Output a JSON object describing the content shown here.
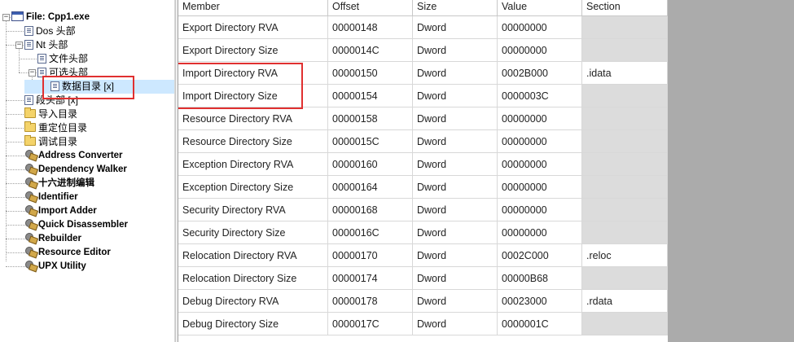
{
  "tree": {
    "items": [
      {
        "label": "File: Cpp1.exe",
        "icon": "window-icon",
        "bold": true,
        "expander": "minus"
      },
      {
        "label": "Dos 头部",
        "icon": "page-icon",
        "bold": false,
        "expander": ""
      },
      {
        "label": "Nt 头部",
        "icon": "page-icon",
        "bold": false,
        "expander": "minus"
      },
      {
        "label": "文件头部",
        "icon": "page-icon",
        "bold": false,
        "expander": ""
      },
      {
        "label": "可选头部",
        "icon": "page-icon",
        "bold": false,
        "expander": "minus"
      },
      {
        "label": "数据目录 [x]",
        "icon": "page-icon",
        "bold": false,
        "expander": "",
        "selected": true
      },
      {
        "label": "段头部 [x]",
        "icon": "page-icon",
        "bold": false,
        "expander": ""
      },
      {
        "label": "导入目录",
        "icon": "folder-icon",
        "bold": false,
        "expander": ""
      },
      {
        "label": "重定位目录",
        "icon": "folder-icon",
        "bold": false,
        "expander": ""
      },
      {
        "label": "调试目录",
        "icon": "folder-icon",
        "bold": false,
        "expander": ""
      },
      {
        "label": "Address Converter",
        "icon": "tool-icon",
        "bold": true,
        "expander": ""
      },
      {
        "label": "Dependency Walker",
        "icon": "tool-icon",
        "bold": true,
        "expander": ""
      },
      {
        "label": "十六进制编辑",
        "icon": "tool-icon",
        "bold": true,
        "expander": ""
      },
      {
        "label": "Identifier",
        "icon": "tool-icon",
        "bold": true,
        "expander": ""
      },
      {
        "label": "Import Adder",
        "icon": "tool-icon",
        "bold": true,
        "expander": ""
      },
      {
        "label": "Quick Disassembler",
        "icon": "tool-icon",
        "bold": true,
        "expander": ""
      },
      {
        "label": "Rebuilder",
        "icon": "tool-icon",
        "bold": true,
        "expander": ""
      },
      {
        "label": "Resource Editor",
        "icon": "tool-icon",
        "bold": true,
        "expander": ""
      },
      {
        "label": "UPX Utility",
        "icon": "tool-icon",
        "bold": true,
        "expander": ""
      }
    ]
  },
  "table": {
    "columns": [
      "Member",
      "Offset",
      "Size",
      "Value",
      "Section"
    ],
    "rows": [
      [
        "Export Directory RVA",
        "00000148",
        "Dword",
        "00000000",
        ""
      ],
      [
        "Export Directory Size",
        "0000014C",
        "Dword",
        "00000000",
        ""
      ],
      [
        "Import Directory RVA",
        "00000150",
        "Dword",
        "0002B000",
        ".idata"
      ],
      [
        "Import Directory Size",
        "00000154",
        "Dword",
        "0000003C",
        ""
      ],
      [
        "Resource Directory RVA",
        "00000158",
        "Dword",
        "00000000",
        ""
      ],
      [
        "Resource Directory Size",
        "0000015C",
        "Dword",
        "00000000",
        ""
      ],
      [
        "Exception Directory RVA",
        "00000160",
        "Dword",
        "00000000",
        ""
      ],
      [
        "Exception Directory Size",
        "00000164",
        "Dword",
        "00000000",
        ""
      ],
      [
        "Security Directory RVA",
        "00000168",
        "Dword",
        "00000000",
        ""
      ],
      [
        "Security Directory Size",
        "0000016C",
        "Dword",
        "00000000",
        ""
      ],
      [
        "Relocation Directory RVA",
        "00000170",
        "Dword",
        "0002C000",
        ".reloc"
      ],
      [
        "Relocation Directory Size",
        "00000174",
        "Dword",
        "00000B68",
        ""
      ],
      [
        "Debug Directory RVA",
        "00000178",
        "Dword",
        "00023000",
        ".rdata"
      ],
      [
        "Debug Directory Size",
        "0000017C",
        "Dword",
        "0000001C",
        ""
      ]
    ]
  },
  "colors": {
    "highlight_border": "#e03030",
    "selection": "#cde8ff",
    "section_column": "#dcdcdc"
  }
}
